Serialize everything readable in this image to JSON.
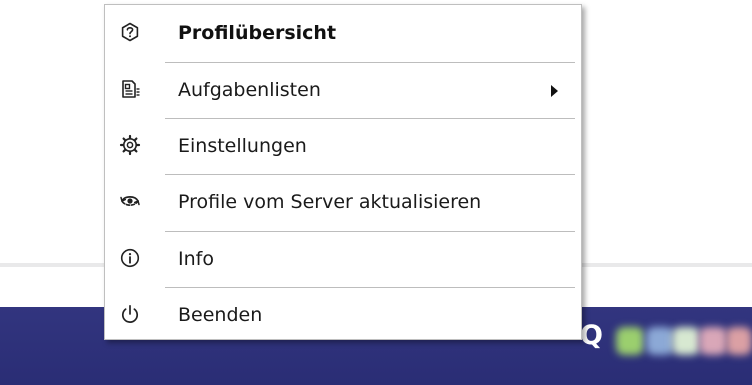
{
  "context_menu": {
    "items": [
      {
        "icon": "question-circle-icon",
        "label": "Profilübersicht",
        "bold": true
      },
      {
        "icon": "document-list-icon",
        "label": "Aufgabenlisten",
        "has_submenu": true
      },
      {
        "icon": "gear-icon",
        "label": "Einstellungen"
      },
      {
        "icon": "eye-refresh-icon",
        "label": "Profile vom Server aktualisieren"
      },
      {
        "icon": "info-circle-icon",
        "label": "Info"
      },
      {
        "icon": "power-icon",
        "label": "Beenden"
      }
    ]
  },
  "taskbar": {
    "tray_app_letter": "Q",
    "background_color": "#2e3178"
  }
}
